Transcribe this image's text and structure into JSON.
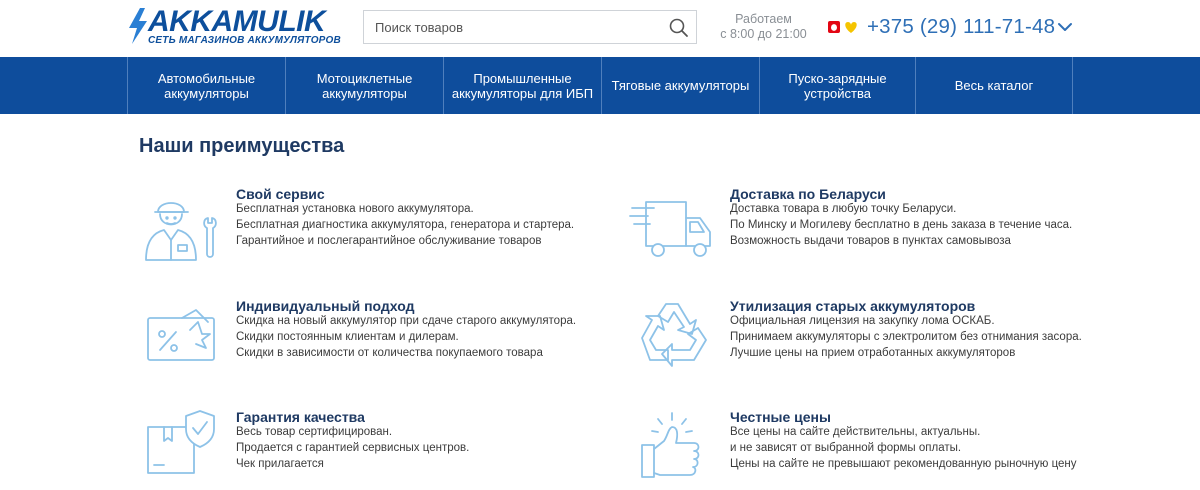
{
  "brand": {
    "name": "AKKAMULIK",
    "tagline": "СЕТЬ МАГАЗИНОВ АККУМУЛЯТОРОВ",
    "color": "#0d4f9c"
  },
  "search": {
    "placeholder": "Поиск товаров",
    "value": ""
  },
  "hours": {
    "line1": "Работаем",
    "line2": "с 8:00 до 21:00"
  },
  "phone": {
    "number": "+375 (29) 111-71-48",
    "color": "#2e6fb6",
    "operator_icons": [
      "mts-icon",
      "life-icon"
    ]
  },
  "nav": {
    "background": "#0e4d9c",
    "items": [
      {
        "line1": "Автомобильные",
        "line2": "аккумуляторы"
      },
      {
        "line1": "Мотоциклетные",
        "line2": "аккумуляторы"
      },
      {
        "line1": "Промышленные",
        "line2": "аккумуляторы для ИБП"
      },
      {
        "line1": "Тяговые аккумуляторы",
        "line2": ""
      },
      {
        "line1": "Пуско-зарядные",
        "line2": "устройства"
      },
      {
        "line1": "Весь каталог",
        "line2": ""
      }
    ]
  },
  "advantages": {
    "title": "Наши преимущества",
    "items": [
      {
        "icon": "mechanic-icon",
        "title": "Свой сервис",
        "lines": [
          "Бесплатная установка нового аккумулятора.",
          "Бесплатная диагностика аккумулятора, генератора и стартера.",
          "Гарантийное и послегарантийное обслуживание товаров"
        ]
      },
      {
        "icon": "delivery-truck-icon",
        "title": "Доставка по Беларуси",
        "lines": [
          "Доставка товара в любую точку Беларуси.",
          "По Минску и Могилеву бесплатно в день заказа в течение часа.",
          "Возможность выдачи товаров в пунктах самовывоза"
        ]
      },
      {
        "icon": "discount-card-icon",
        "title": "Индивидуальный подход",
        "lines": [
          "Скидка на новый аккумулятор при сдаче старого аккумулятора.",
          "Скидки постоянным клиентам и дилерам.",
          "Скидки в зависимости от количества покупаемого товара"
        ]
      },
      {
        "icon": "recycle-icon",
        "title": "Утилизация старых аккумуляторов",
        "lines": [
          "Официальная лицензия на закупку лома ОСКАБ.",
          "Принимаем аккумуляторы с электролитом без отнимания засора.",
          "Лучшие цены на прием отработанных аккумуляторов"
        ]
      },
      {
        "icon": "certified-box-icon",
        "title": "Гарантия качества",
        "lines": [
          "Весь товар сертифицирован.",
          "Продается с гарантией сервисных центров.",
          "Чек прилагается"
        ]
      },
      {
        "icon": "thumbs-up-icon",
        "title": "Честные цены",
        "lines": [
          "Все цены на сайте действительны, актуальны.",
          "и не зависят от выбранной формы оплаты.",
          "Цены на сайте не превышают рекомендованную рыночную цену"
        ]
      }
    ]
  }
}
